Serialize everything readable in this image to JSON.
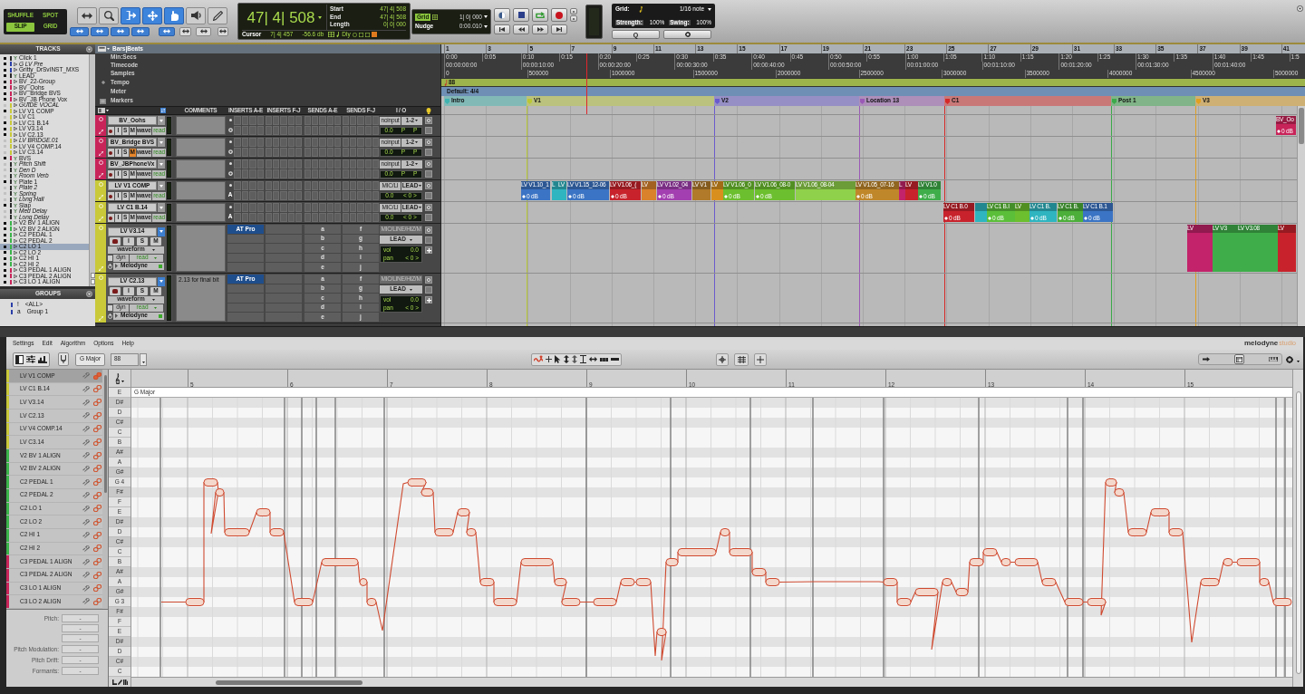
{
  "toolbar": {
    "edit_modes": [
      {
        "label": "SHUFFLE",
        "selected": false
      },
      {
        "label": "SPOT",
        "selected": false
      },
      {
        "label": "SLIP",
        "selected": true
      },
      {
        "label": "GRID",
        "selected": false
      }
    ],
    "tools": [
      {
        "kind": "zoom-toggle",
        "selected": false
      },
      {
        "kind": "zoomer",
        "selected": false
      },
      {
        "kind": "trim",
        "selected": true
      },
      {
        "kind": "selector",
        "selected": true
      },
      {
        "kind": "grabber",
        "selected": true
      },
      {
        "kind": "scrub",
        "selected": false
      },
      {
        "kind": "pencil",
        "selected": false
      }
    ],
    "counter": {
      "main": "47| 4| 508",
      "rows": [
        {
          "label": "Start",
          "value": "47| 4| 508"
        },
        {
          "label": "End",
          "value": "47| 4| 508"
        },
        {
          "label": "Length",
          "value": "0| 0| 000"
        }
      ],
      "cursor_label": "Cursor",
      "cursor_value": "7| 4| 457",
      "level": "-56.6 db",
      "delay": "Dly"
    },
    "grid": {
      "label": "Grid",
      "value": "1| 0| 000"
    },
    "nudge": {
      "label": "Nudge",
      "value": "0:00.010"
    },
    "quantize": {
      "grid_label": "Grid:",
      "grid_value": "1/16 note",
      "strength_label": "Strength:",
      "strength_value": "100%",
      "swing_label": "Swing:",
      "swing_value": "100%",
      "button": "Q"
    }
  },
  "tracks_panel": {
    "title": "TRACKS",
    "tracks": [
      {
        "name": "Click 1",
        "color": "#2a2a2a",
        "kind": "aux",
        "shown": true,
        "inactive": false,
        "selected": false
      },
      {
        "name": "G LV Pre",
        "color": "#2b3fa8",
        "kind": "audio",
        "shown": true,
        "inactive": true,
        "selected": false
      },
      {
        "name": "Gritty_DrSvINST_MXS",
        "color": "#2b3fa8",
        "kind": "audio",
        "shown": true,
        "inactive": false,
        "selected": false
      },
      {
        "name": "LEAD",
        "color": "#2a2a2a",
        "kind": "aux",
        "shown": true,
        "inactive": false,
        "selected": false
      },
      {
        "name": "BV_22-Group",
        "color": "#c8245a",
        "kind": "audio",
        "shown": true,
        "inactive": false,
        "selected": false
      },
      {
        "name": "BV_Oohs",
        "color": "#c8245a",
        "kind": "audio",
        "shown": true,
        "inactive": false,
        "selected": false
      },
      {
        "name": "BV_Bridge BVS",
        "color": "#c8245a",
        "kind": "audio",
        "shown": true,
        "inactive": false,
        "selected": false
      },
      {
        "name": "BV_JB Phone Vox",
        "color": "#c8245a",
        "kind": "audio",
        "shown": true,
        "inactive": false,
        "selected": false
      },
      {
        "name": "GUIDE VOCAL",
        "color": "#c9c93a",
        "kind": "audio",
        "shown": false,
        "inactive": true,
        "selected": false
      },
      {
        "name": "LV V1 COMP",
        "color": "#c9c93a",
        "kind": "audio",
        "shown": true,
        "inactive": false,
        "selected": false
      },
      {
        "name": "LV C1",
        "color": "#c9c93a",
        "kind": "audio",
        "shown": false,
        "inactive": false,
        "selected": false
      },
      {
        "name": "LV C1 B.14",
        "color": "#c9c93a",
        "kind": "audio",
        "shown": true,
        "inactive": false,
        "selected": false
      },
      {
        "name": "LV V3.14",
        "color": "#c9c93a",
        "kind": "audio",
        "shown": true,
        "inactive": false,
        "selected": false
      },
      {
        "name": "LV C2.13",
        "color": "#c9c93a",
        "kind": "audio",
        "shown": true,
        "inactive": false,
        "selected": false
      },
      {
        "name": "LV BRIDGE.01",
        "color": "#c9c93a",
        "kind": "audio",
        "shown": false,
        "inactive": true,
        "selected": false
      },
      {
        "name": "LV V4 COMP.14",
        "color": "#c9c93a",
        "kind": "audio",
        "shown": false,
        "inactive": false,
        "selected": false
      },
      {
        "name": "LV C3.14",
        "color": "#c9c93a",
        "kind": "audio",
        "shown": false,
        "inactive": false,
        "selected": false
      },
      {
        "name": "BVS",
        "color": "#c8245a",
        "kind": "aux",
        "shown": true,
        "inactive": false,
        "selected": false
      },
      {
        "name": "Pitch Shift",
        "color": "#2a2a2a",
        "kind": "aux",
        "shown": false,
        "inactive": true,
        "selected": false
      },
      {
        "name": "Den D",
        "color": "#2a2a2a",
        "kind": "aux",
        "shown": false,
        "inactive": true,
        "selected": false
      },
      {
        "name": "Room Verb",
        "color": "#2a2a2a",
        "kind": "aux",
        "shown": false,
        "inactive": true,
        "selected": false
      },
      {
        "name": "Plate 1",
        "color": "#2a2a2a",
        "kind": "aux",
        "shown": true,
        "inactive": false,
        "selected": false
      },
      {
        "name": "Plate 2",
        "color": "#2a2a2a",
        "kind": "aux",
        "shown": false,
        "inactive": true,
        "selected": false
      },
      {
        "name": "Spring",
        "color": "#2a2a2a",
        "kind": "aux",
        "shown": false,
        "inactive": true,
        "selected": false
      },
      {
        "name": "Long Hall",
        "color": "#2a2a2a",
        "kind": "aux",
        "shown": false,
        "inactive": true,
        "selected": false
      },
      {
        "name": "Slap",
        "color": "#2a2a2a",
        "kind": "aux",
        "shown": true,
        "inactive": false,
        "selected": false
      },
      {
        "name": "Med Delay",
        "color": "#2a2a2a",
        "kind": "aux",
        "shown": false,
        "inactive": true,
        "selected": false
      },
      {
        "name": "Long Delay",
        "color": "#2a2a2a",
        "kind": "aux",
        "shown": false,
        "inactive": true,
        "selected": false
      },
      {
        "name": "V2 BV 1 ALIGN",
        "color": "#3bb44a",
        "kind": "audio",
        "shown": true,
        "inactive": false,
        "selected": false
      },
      {
        "name": "V2 BV 2 ALIGN",
        "color": "#3bb44a",
        "kind": "audio",
        "shown": true,
        "inactive": false,
        "selected": false
      },
      {
        "name": "C2 PEDAL 1",
        "color": "#3bb44a",
        "kind": "audio",
        "shown": true,
        "inactive": false,
        "selected": false
      },
      {
        "name": "C2 PEDAL 2",
        "color": "#3bb44a",
        "kind": "audio",
        "shown": true,
        "inactive": false,
        "selected": false
      },
      {
        "name": "C2 LO 1",
        "color": "#3bb44a",
        "kind": "audio",
        "shown": true,
        "inactive": false,
        "selected": true
      },
      {
        "name": "C2 LO 2",
        "color": "#3bb44a",
        "kind": "audio",
        "shown": true,
        "inactive": false,
        "selected": false
      },
      {
        "name": "C2 HI 1",
        "color": "#3bb44a",
        "kind": "audio",
        "shown": true,
        "inactive": false,
        "selected": false
      },
      {
        "name": "C2 HI 2",
        "color": "#3bb44a",
        "kind": "audio",
        "shown": true,
        "inactive": false,
        "selected": false
      },
      {
        "name": "C3 PEDAL 1 ALIGN",
        "color": "#c8245a",
        "kind": "audio",
        "shown": true,
        "inactive": false,
        "selected": false
      },
      {
        "name": "C3 PEDAL 2 ALIGN",
        "color": "#c8245a",
        "kind": "audio",
        "shown": true,
        "inactive": false,
        "selected": false
      },
      {
        "name": "C3 LO 1 ALIGN",
        "color": "#c8245a",
        "kind": "audio",
        "shown": true,
        "inactive": false,
        "selected": false
      }
    ]
  },
  "groups_panel": {
    "title": "GROUPS",
    "groups": [
      {
        "id": "!",
        "name": "<ALL>"
      },
      {
        "id": "a",
        "name": "Group 1"
      }
    ]
  },
  "rulers": {
    "bars": {
      "label": "Bars|Beats",
      "ticks": [
        "1",
        "3",
        "5",
        "7",
        "9",
        "11",
        "13",
        "15",
        "17",
        "19",
        "21",
        "23",
        "25",
        "27",
        "29",
        "31",
        "33",
        "35",
        "37",
        "39",
        "41"
      ]
    },
    "minsecs": {
      "label": "Min:Secs",
      "ticks": [
        "0:00",
        "0:05",
        "0:10",
        "0:15",
        "0:20",
        "0:25",
        "0:30",
        "0:35",
        "0:40",
        "0:45",
        "0:50",
        "0:55",
        "1:00",
        "1:05",
        "1:10",
        "1:15",
        "1:20",
        "1:25",
        "1:30",
        "1:35",
        "1:40",
        "1:45",
        "1:5"
      ]
    },
    "timecode": {
      "label": "Timecode",
      "ticks": [
        "00:00:00:00",
        "00:00:10:00",
        "00:00:20:00",
        "00:00:30:00",
        "00:00:40:00",
        "00:00:50:00",
        "00:01:00:00",
        "00:01:10:00",
        "00:01:20:00",
        "00:01:30:00",
        "00:01:40:00"
      ]
    },
    "samples": {
      "label": "Samples",
      "ticks": [
        "0",
        "500000",
        "1000000",
        "1500000",
        "2000000",
        "2500000",
        "3000000",
        "3500000",
        "4000000",
        "4500000",
        "5000000"
      ]
    },
    "tempo": {
      "label": "Tempo",
      "value": "88"
    },
    "meter": {
      "label": "Meter",
      "value": "Default: 4/4"
    },
    "markers": {
      "label": "Markers",
      "items": [
        {
          "name": "Intro",
          "color": "#3fb3b0"
        },
        {
          "name": "V1",
          "color": "#b9c834"
        },
        {
          "name": "V2",
          "color": "#6a5acd"
        },
        {
          "name": "Location 13",
          "color": "#9b59b6"
        },
        {
          "name": "C1",
          "color": "#d62828"
        },
        {
          "name": "Post 1",
          "color": "#3caa4a"
        },
        {
          "name": "V3",
          "color": "#e0a020"
        }
      ]
    }
  },
  "mix_columns": [
    "COMMENTS",
    "INSERTS A-E",
    "INSERTS F-J",
    "SENDS A-E",
    "SENDS F-J",
    "I / O"
  ],
  "strips": [
    {
      "name": "BV_Oohs",
      "color": "#c8245a",
      "kind": "short",
      "buttons": [
        {
          "label": "I",
          "kind": "input",
          "on": false
        },
        {
          "label": "S",
          "kind": "solo",
          "on": false
        },
        {
          "label": "M",
          "kind": "mute",
          "on": false
        }
      ],
      "view": "wave",
      "automation": "read",
      "input": "noinput",
      "output": "1-2",
      "volume": "0.0",
      "pan": [
        "P",
        "P"
      ],
      "clips": [
        {
          "name": "BV_Oo",
          "gain": "0 dB",
          "color": "#c8245a"
        }
      ]
    },
    {
      "name": "BV_Bridge BVS",
      "color": "#c8245a",
      "kind": "short",
      "buttons": [
        {
          "label": "I",
          "kind": "input",
          "on": false
        },
        {
          "label": "S",
          "kind": "solo",
          "on": false
        },
        {
          "label": "M",
          "kind": "mute",
          "on": true
        }
      ],
      "view": "wave",
      "automation": "read",
      "input": "noinput",
      "output": "1-2",
      "volume": "0.0",
      "pan": [
        "P",
        "P"
      ]
    },
    {
      "name": "BV_JBPhoneVx",
      "color": "#c8245a",
      "kind": "short",
      "buttons": [
        {
          "label": "I",
          "kind": "input",
          "on": false
        },
        {
          "label": "S",
          "kind": "solo",
          "on": false
        },
        {
          "label": "M",
          "kind": "mute",
          "on": false
        }
      ],
      "view": "wave",
      "automation": "read",
      "input": "noinput",
      "output": "1-2",
      "volume": "0.0",
      "pan": [
        "P",
        "P"
      ]
    },
    {
      "name": "LV V1 COMP",
      "color": "#c9c93a",
      "kind": "short",
      "insert_mark": "A",
      "buttons": [
        {
          "label": "I",
          "kind": "input",
          "on": false
        },
        {
          "label": "S",
          "kind": "solo",
          "on": false
        },
        {
          "label": "M",
          "kind": "mute",
          "on": false
        }
      ],
      "view": "wave",
      "automation": "read",
      "input": "MIC/LI",
      "output": "LEAD",
      "volume": "0.0",
      "pan": [
        "< 0 >"
      ],
      "clips": [
        {
          "name": "LV V1.10_1",
          "gain": "0 dB",
          "color": "#3b74c4"
        },
        {
          "name": "L",
          "color": "#2fb5c0"
        },
        {
          "name": "LV",
          "color": "#2fb5c0"
        },
        {
          "name": "LV V1.15_12-06",
          "gain": "0 dB",
          "color": "#3b74c4"
        },
        {
          "name": "LV V1.06_(",
          "gain": "0 dB",
          "color": "#c8232c"
        },
        {
          "name": "LV",
          "color": "#d9822b"
        },
        {
          "name": "LV V1.02_04",
          "gain": "0 dB",
          "color": "#a33fb0"
        },
        {
          "name": "LV V1",
          "color": "#b07a2a"
        },
        {
          "name": "LV",
          "color": "#d98f1e"
        },
        {
          "name": "LV V1.06_0",
          "gain": "0 dB",
          "color": "#6cbf2e"
        },
        {
          "name": "LV V1.06_08-0",
          "gain": "0 dB",
          "color": "#6cbf2e"
        },
        {
          "name": "LV V1.06_08-04",
          "color": "#8fd14a"
        },
        {
          "name": "LV V1.05_07-16",
          "gain": "0 dB",
          "color": "#c0872a"
        },
        {
          "name": "L",
          "color": "#c2236a"
        },
        {
          "name": "LV",
          "color": "#c8232c"
        },
        {
          "name": "LV V1.0",
          "gain": "0 dB",
          "color": "#3fae4a"
        }
      ]
    },
    {
      "name": "LV C1 B.14",
      "color": "#c9c93a",
      "kind": "short",
      "insert_mark": "A",
      "buttons": [
        {
          "label": "I",
          "kind": "input",
          "on": false
        },
        {
          "label": "S",
          "kind": "solo",
          "on": false
        },
        {
          "label": "M",
          "kind": "mute",
          "on": false
        }
      ],
      "view": "wave",
      "automation": "read",
      "input": "MIC/LI",
      "output": "LEAD",
      "volume": "0.0",
      "pan": [
        "< 0 >"
      ],
      "clips": [
        {
          "name": "LV C1 B.0",
          "gain": "0 dB",
          "color": "#c8232c"
        },
        {
          "color": "#2fb5c0"
        },
        {
          "name": "LV C1 B.I",
          "gain": "0 dB",
          "color": "#5cbf3a"
        },
        {
          "name": "LV",
          "color": "#6cbf2e"
        },
        {
          "name": "LV C1 B.",
          "gain": "0 dB",
          "color": "#2fb5c0"
        },
        {
          "name": "LV C1 B.",
          "gain": "0 dB",
          "color": "#4caf3a"
        },
        {
          "name": "LV C1 B.1",
          "gain": "0 dB",
          "color": "#3b74c4"
        }
      ]
    },
    {
      "name": "LV V3.14",
      "color": "#c9c93a",
      "kind": "tall",
      "buttons": [
        {
          "label": "I",
          "kind": "input",
          "on": false
        },
        {
          "label": "S",
          "kind": "solo",
          "on": false
        },
        {
          "label": "M",
          "kind": "mute",
          "on": false
        }
      ],
      "view": "waveform",
      "dynamics": "dyn",
      "automation": "read",
      "plugin": "Melodyne",
      "inserts": [
        "AT Pro"
      ],
      "sends_a": [
        "a",
        "b",
        "c",
        "d",
        "e"
      ],
      "sends_f": [
        "f",
        "g",
        "h",
        "i",
        "j"
      ],
      "input": "MIC/LINE/HIZ/M",
      "output": "LEAD",
      "volume_label": "vol",
      "volume": "0.0",
      "pan_label": "pan",
      "pan": [
        "< 0 >"
      ],
      "clips": [
        {
          "name": "LV",
          "color": "#c2236a"
        },
        {
          "name": "LV V3",
          "color": "#3fae4a"
        },
        {
          "name": "LV V3.08",
          "color": "#3fae4a"
        },
        {
          "name": "LV",
          "color": "#c8232c"
        }
      ]
    },
    {
      "name": "LV C2.13",
      "color": "#c9c93a",
      "kind": "tall",
      "comment": "2.13 for final bit",
      "buttons": [
        {
          "label": "I",
          "kind": "input",
          "on": false
        },
        {
          "label": "S",
          "kind": "solo",
          "on": false
        },
        {
          "label": "M",
          "kind": "mute",
          "on": false
        }
      ],
      "view": "waveform",
      "dynamics": "dyn",
      "automation": "read",
      "plugin": "Melodyne",
      "inserts": [
        "AT Pro"
      ],
      "sends_a": [
        "a",
        "b",
        "c",
        "d",
        "e"
      ],
      "sends_f": [
        "f",
        "g",
        "h",
        "i",
        "j"
      ],
      "input": "MIC/LINE/HIZ/M",
      "output": "LEAD",
      "volume_label": "vol",
      "volume": "0.0",
      "pan_label": "pan",
      "pan": [
        "< 0 >"
      ]
    }
  ],
  "melodyne": {
    "menu": [
      "Settings",
      "Edit",
      "Algorithm",
      "Options",
      "Help"
    ],
    "logo": {
      "name": "melodyne",
      "edition": "studio"
    },
    "scale_button": "G Major",
    "tempo": "88",
    "tracks": [
      {
        "name": "LV V1 COMP",
        "color": "#c9c93a",
        "selected": true
      },
      {
        "name": "LV C1 B.14",
        "color": "#c9c93a",
        "selected": false
      },
      {
        "name": "LV V3.14",
        "color": "#c9c93a",
        "selected": false
      },
      {
        "name": "LV C2.13",
        "color": "#c9c93a",
        "selected": false
      },
      {
        "name": "LV V4 COMP.14",
        "color": "#c9c93a",
        "selected": false
      },
      {
        "name": "LV C3.14",
        "color": "#c9c93a",
        "selected": false
      },
      {
        "name": "V2 BV 1 ALIGN",
        "color": "#3bb44a",
        "selected": false
      },
      {
        "name": "V2 BV 2 ALIGN",
        "color": "#3bb44a",
        "selected": false
      },
      {
        "name": "C2 PEDAL 1",
        "color": "#3bb44a",
        "selected": false
      },
      {
        "name": "C2 PEDAL 2",
        "color": "#3bb44a",
        "selected": false
      },
      {
        "name": "C2 LO 1",
        "color": "#3bb44a",
        "selected": false
      },
      {
        "name": "C2 LO 2",
        "color": "#3bb44a",
        "selected": false
      },
      {
        "name": "C2 HI 1",
        "color": "#3bb44a",
        "selected": false
      },
      {
        "name": "C2 HI 2",
        "color": "#3bb44a",
        "selected": false
      },
      {
        "name": "C3 PEDAL 1 ALIGN",
        "color": "#c8245a",
        "selected": false
      },
      {
        "name": "C3 PEDAL 2 ALIGN",
        "color": "#c8245a",
        "selected": false
      },
      {
        "name": "C3 LO 1 ALIGN",
        "color": "#c8245a",
        "selected": false
      },
      {
        "name": "C3 LO 2 ALIGN",
        "color": "#c8245a",
        "selected": false
      }
    ],
    "parameters": [
      {
        "label": "Pitch:",
        "fields": [
          "-",
          "-",
          "-"
        ]
      },
      {
        "label": "Pitch Modulation:",
        "fields": [
          "-"
        ]
      },
      {
        "label": "Pitch Drift:",
        "fields": [
          "-"
        ]
      },
      {
        "label": "Formants:",
        "fields": [
          "-"
        ]
      }
    ],
    "bars": [
      "5",
      "6",
      "7",
      "8",
      "9",
      "10",
      "11",
      "12",
      "13",
      "14",
      "15"
    ],
    "scale": "G Major",
    "pitch_rows": [
      {
        "name": "E",
        "kind": "white"
      },
      {
        "name": "D#",
        "kind": "black"
      },
      {
        "name": "D",
        "kind": "white"
      },
      {
        "name": "C#",
        "kind": "black"
      },
      {
        "name": "C",
        "kind": "white"
      },
      {
        "name": "B",
        "kind": "white"
      },
      {
        "name": "A#",
        "kind": "black"
      },
      {
        "name": "A",
        "kind": "white"
      },
      {
        "name": "G#",
        "kind": "black"
      },
      {
        "name": "G 4",
        "kind": "white"
      },
      {
        "name": "F#",
        "kind": "black"
      },
      {
        "name": "F",
        "kind": "white"
      },
      {
        "name": "E",
        "kind": "white"
      },
      {
        "name": "D#",
        "kind": "black"
      },
      {
        "name": "D",
        "kind": "white"
      },
      {
        "name": "C#",
        "kind": "black"
      },
      {
        "name": "C",
        "kind": "white"
      },
      {
        "name": "B",
        "kind": "white"
      },
      {
        "name": "A#",
        "kind": "black"
      },
      {
        "name": "A",
        "kind": "white"
      },
      {
        "name": "G#",
        "kind": "black"
      },
      {
        "name": "G 3",
        "kind": "white"
      },
      {
        "name": "F#",
        "kind": "black"
      },
      {
        "name": "F",
        "kind": "white"
      },
      {
        "name": "E",
        "kind": "white"
      },
      {
        "name": "D#",
        "kind": "black"
      },
      {
        "name": "D",
        "kind": "white"
      },
      {
        "name": "C#",
        "kind": "black"
      },
      {
        "name": "C",
        "kind": "white"
      }
    ]
  }
}
